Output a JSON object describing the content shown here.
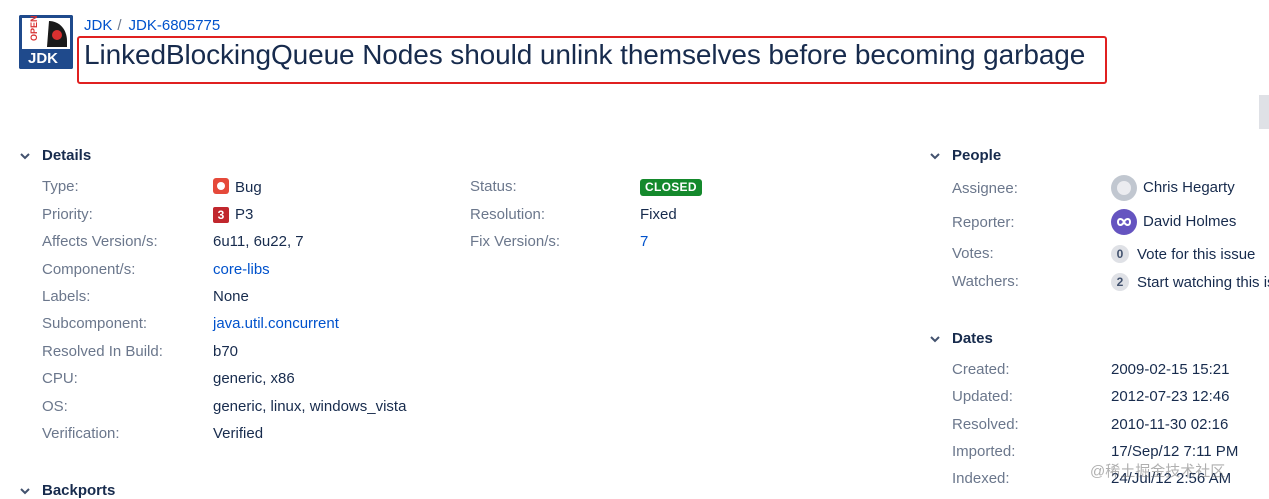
{
  "header": {
    "breadcrumb": {
      "project": "JDK",
      "separator": "/",
      "issue_key": "JDK-6805775"
    },
    "title": "LinkedBlockingQueue Nodes should unlink themselves before becoming garbage",
    "logo_text": "OPEN JDK"
  },
  "details": {
    "heading": "Details",
    "left": [
      {
        "label": "Type:",
        "value": "Bug",
        "icon": "bug-icon"
      },
      {
        "label": "Priority:",
        "value": "P3",
        "icon": "priority-3-icon",
        "icon_text": "3"
      },
      {
        "label": "Affects Version/s:",
        "value": "6u11, 6u22, 7"
      },
      {
        "label": "Component/s:",
        "value": "core-libs",
        "link": true
      },
      {
        "label": "Labels:",
        "value": "None"
      },
      {
        "label": "Subcomponent:",
        "value": "java.util.concurrent",
        "link": true
      },
      {
        "label": "Resolved In Build:",
        "value": "b70"
      },
      {
        "label": "CPU:",
        "value": "generic, x86"
      },
      {
        "label": "OS:",
        "value": "generic, linux, windows_vista"
      },
      {
        "label": "Verification:",
        "value": "Verified"
      }
    ],
    "right": [
      {
        "label": "Status:",
        "value": "CLOSED",
        "badge_color": "#14892c"
      },
      {
        "label": "Resolution:",
        "value": "Fixed"
      },
      {
        "label": "Fix Version/s:",
        "value": "7",
        "link": true
      }
    ]
  },
  "people": {
    "heading": "People",
    "assignee": {
      "label": "Assignee:",
      "value": "Chris Hegarty"
    },
    "reporter": {
      "label": "Reporter:",
      "value": "David Holmes"
    },
    "votes": {
      "label": "Votes:",
      "count": "0",
      "action": "Vote for this issue"
    },
    "watchers": {
      "label": "Watchers:",
      "count": "2",
      "action": "Start watching this issue"
    }
  },
  "dates": {
    "heading": "Dates",
    "rows": [
      {
        "label": "Created:",
        "value": "2009-02-15 15:21"
      },
      {
        "label": "Updated:",
        "value": "2012-07-23 12:46"
      },
      {
        "label": "Resolved:",
        "value": "2010-11-30 02:16"
      },
      {
        "label": "Imported:",
        "value": "17/Sep/12 7:11 PM"
      },
      {
        "label": "Indexed:",
        "value": "24/Jul/12 2:56 AM"
      }
    ]
  },
  "backports": {
    "heading": "Backports"
  },
  "watermark": "@稀土掘金技术社区",
  "colors": {
    "link": "#0052cc",
    "highlight_border": "#e02020",
    "text": "#172b4d",
    "label": "#6b778c"
  }
}
